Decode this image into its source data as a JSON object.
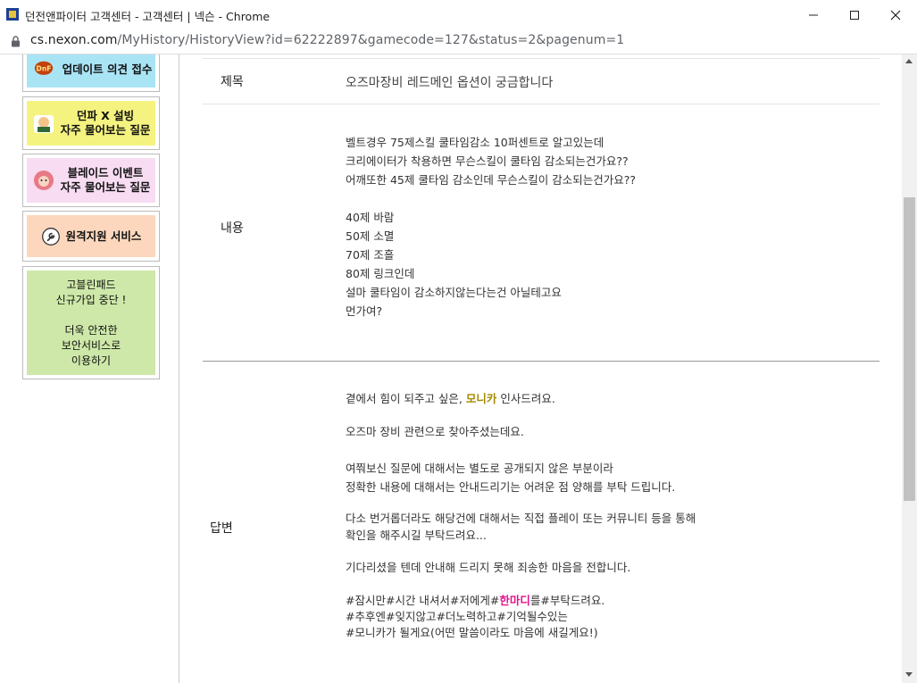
{
  "window": {
    "title": "던전앤파이터 고객센터 - 고객센터 | 넥슨 - Chrome",
    "minimize": "─",
    "maximize": "☐",
    "close": "✕"
  },
  "address": {
    "domain": "cs.nexon.com",
    "path": "/MyHistory/HistoryView?id=62222897&gamecode=127&status=2&pagenum=1"
  },
  "sidebar": {
    "banners": [
      {
        "label": "업데이트 의견 접수",
        "icon": "dnf-logo-icon"
      },
      {
        "line1": "던파 X 설빙",
        "line2": "자주 물어보는 질문",
        "icon": "character-icon"
      },
      {
        "line1": "블레이드 이벤트",
        "line2": "자주 물어보는 질문",
        "icon": "character-icon"
      },
      {
        "label": "원격지원 서비스",
        "icon": "wrench-icon"
      },
      {
        "line1": "고블린패드",
        "line2": "신규가입 중단 !",
        "line3": "더욱 안전한",
        "line4": "보안서비스로",
        "line5": "이용하기"
      }
    ]
  },
  "inquiry": {
    "subject_label": "제목",
    "subject": "오즈마장비 레드메인 옵션이 궁금합니다",
    "content_label": "내용",
    "content": "벨트경우 75제스킬 쿨타임감소 10퍼센트로 알고있는데\n크리에이터가 착용하면 무슨스킬이 쿨타임 감소되는건가요??\n어깨또한 45제 쿨타임 감소인데 무슨스킬이 감소되는건가요??\n\n40제 바람\n50제 소멸\n70제 조흘\n80제 링크인데\n설마 쿨타임이 감소하지않는다는건 아닐테고요\n먼가여?"
  },
  "answer": {
    "label": "답변",
    "greeting_pre": "곁에서 힘이 되주고 싶은, ",
    "greeting_name": "모니카",
    "greeting_post": " 인사드려요.",
    "p1": "오즈마 장비 관련으로 찾아주셨는데요.",
    "p2": "여쭤보신 질문에 대해서는 별도로 공개되지 않은 부분이라\n정확한 내용에 대해서는 안내드리기는 어려운 점 양해를 부탁 드립니다.",
    "p3": "다소 번거롭더라도 해당건에 대해서는 직접 플레이 또는 커뮤니티 등을 통해\n확인을 해주시길 부탁드려요...",
    "p4": "기다리셨을 텐데 안내해 드리지 못해 죄송한 마음을 전합니다.",
    "tag1_pre": "#잠시만#시간 내셔서#저에게#",
    "tag1_hl": "한마디",
    "tag1_post": "를#부탁드려요.",
    "tag2": "#추후엔#잊지않고#더노력하고#기억될수있는",
    "tag3": "#모니카가 될게요(어떤 말씀이라도 마음에 새길게요!)"
  }
}
